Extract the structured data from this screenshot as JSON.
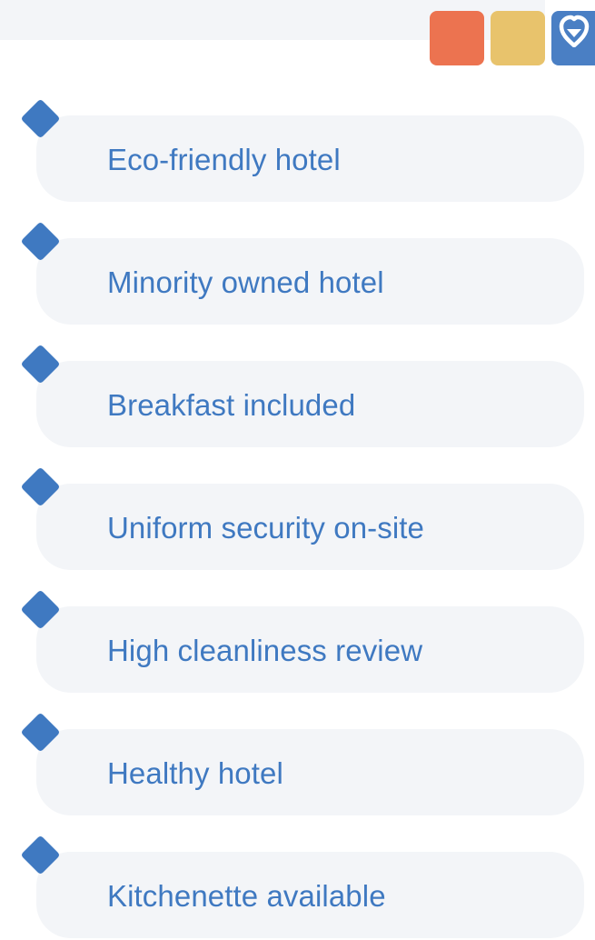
{
  "header": {
    "swatches": [
      {
        "name": "orange",
        "color": "#ec7350"
      },
      {
        "name": "yellow",
        "color": "#e8c36c"
      },
      {
        "name": "blue",
        "color": "#4a7fc4",
        "icon": "heart-shield-icon"
      }
    ]
  },
  "colors": {
    "accent": "#3f79c1",
    "card_background": "#f3f5f8"
  },
  "list": {
    "items": [
      {
        "label": "Eco-friendly hotel"
      },
      {
        "label": "Minority owned hotel"
      },
      {
        "label": "Breakfast included"
      },
      {
        "label": "Uniform security on-site"
      },
      {
        "label": "High cleanliness review"
      },
      {
        "label": "Healthy hotel"
      },
      {
        "label": "Kitchenette available"
      }
    ]
  }
}
